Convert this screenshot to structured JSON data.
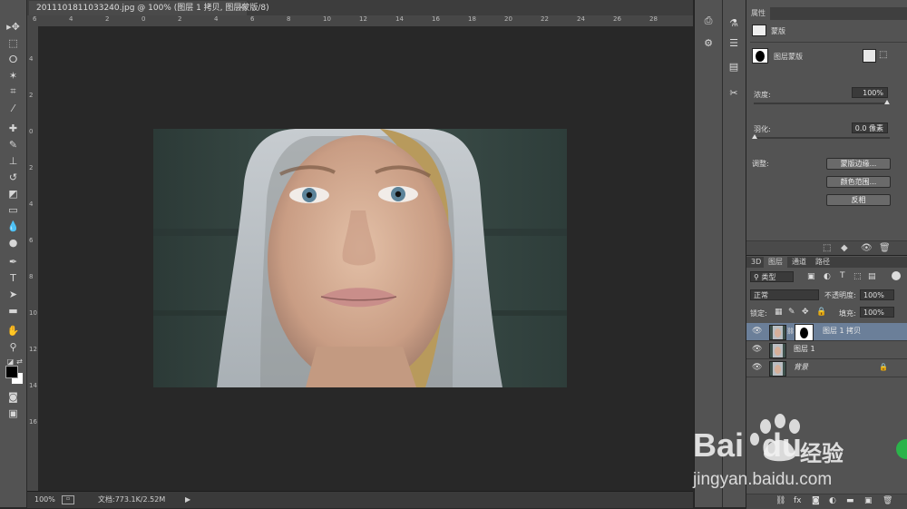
{
  "document": {
    "tab_title": "2011101811033240.jpg @ 100% (图层 1 拷贝, 图层蒙版/8)",
    "close_glyph": "×"
  },
  "rulers": {
    "horizontal": [
      "6",
      "4",
      "2",
      "0",
      "2",
      "4",
      "6",
      "8",
      "10",
      "12",
      "14",
      "16",
      "18",
      "20",
      "22",
      "24",
      "26",
      "28"
    ],
    "vertical": [
      "6",
      "4",
      "2",
      "0",
      "2",
      "4",
      "6",
      "8",
      "10",
      "12",
      "14",
      "16"
    ]
  },
  "status": {
    "zoom": "100%",
    "doc_info": "文档:773.1K/2.52M"
  },
  "properties": {
    "tab": "属性",
    "type_label": "蒙版",
    "mask_label": "图层蒙版",
    "density_label": "浓度:",
    "density_value": "100%",
    "feather_label": "羽化:",
    "feather_value": "0.0 像素",
    "adjust_label": "调整:",
    "btn_mask_edge": "蒙版边缘...",
    "btn_color_range": "颜色范围...",
    "btn_invert": "反相"
  },
  "layers": {
    "tabs": [
      "3D",
      "图层",
      "通道",
      "路径"
    ],
    "filter_label": "类型",
    "blend_mode": "正常",
    "opacity_label": "不透明度:",
    "opacity_value": "100%",
    "lock_label": "锁定:",
    "fill_label": "填充:",
    "fill_value": "100%",
    "items": [
      {
        "name": "图层 1 拷贝"
      },
      {
        "name": "图层 1"
      },
      {
        "name": "背景"
      }
    ],
    "footer_icons": [
      "link-icon",
      "fx-icon",
      "mask-icon",
      "adjustment-icon",
      "group-icon",
      "new-layer-icon",
      "trash-icon"
    ]
  },
  "watermark": {
    "brand_a": "Bai",
    "brand_b": "du",
    "suffix": "经验",
    "url": "jingyan.baidu.com"
  },
  "colors": {
    "workspace": "#282828",
    "panel": "#535353",
    "selected_layer": "#6b7f99"
  }
}
